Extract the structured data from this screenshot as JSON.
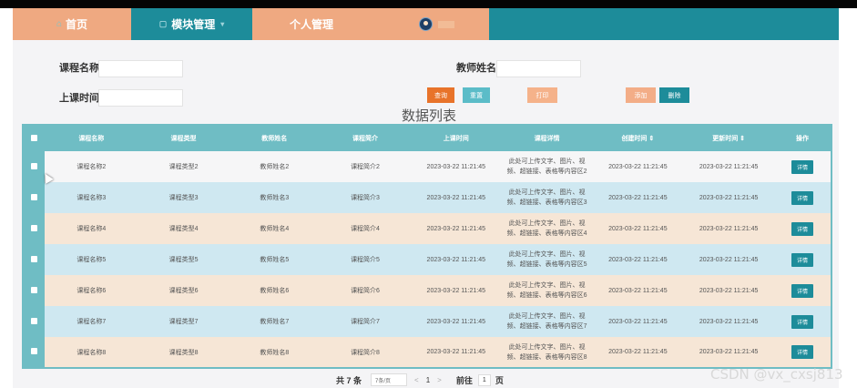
{
  "nav": {
    "home": "首页",
    "module": "模块管理",
    "personal": "个人管理",
    "username": ""
  },
  "search": {
    "course_name_label": "课程名称",
    "teacher_name_label": "教师姓名",
    "class_time_label": "上课时间",
    "course_name_value": "",
    "teacher_name_value": "",
    "class_time_value": ""
  },
  "buttons": {
    "query": "查询",
    "reset": "重置",
    "print": "打印",
    "add": "添加",
    "delete": "删除"
  },
  "list_title": "数据列表",
  "table": {
    "headers": [
      "课程名称",
      "课程类型",
      "教师姓名",
      "课程简介",
      "上课时间",
      "课程详情",
      "创建时间 ⇕",
      "更新时间 ⇕",
      "操作"
    ],
    "rows": [
      {
        "name": "课程名称2",
        "type": "课程类型2",
        "teacher": "教师姓名2",
        "intro": "课程简介2",
        "time": "2023-03-22 11:21:45",
        "detail_1": "此处可上传文字、图片、视",
        "detail_2": "频、超链接、表格等内容区2",
        "created": "2023-03-22 11:21:45",
        "updated": "2023-03-22 11:21:45",
        "action": "详情"
      },
      {
        "name": "课程名称3",
        "type": "课程类型3",
        "teacher": "教师姓名3",
        "intro": "课程简介3",
        "time": "2023-03-22 11:21:45",
        "detail_1": "此处可上传文字、图片、视",
        "detail_2": "频、超链接、表格等内容区3",
        "created": "2023-03-22 11:21:45",
        "updated": "2023-03-22 11:21:45",
        "action": "详情"
      },
      {
        "name": "课程名称4",
        "type": "课程类型4",
        "teacher": "教师姓名4",
        "intro": "课程简介4",
        "time": "2023-03-22 11:21:45",
        "detail_1": "此处可上传文字、图片、视",
        "detail_2": "频、超链接、表格等内容区4",
        "created": "2023-03-22 11:21:45",
        "updated": "2023-03-22 11:21:45",
        "action": "详情"
      },
      {
        "name": "课程名称5",
        "type": "课程类型5",
        "teacher": "教师姓名5",
        "intro": "课程简介5",
        "time": "2023-03-22 11:21:45",
        "detail_1": "此处可上传文字、图片、视",
        "detail_2": "频、超链接、表格等内容区5",
        "created": "2023-03-22 11:21:45",
        "updated": "2023-03-22 11:21:45",
        "action": "详情"
      },
      {
        "name": "课程名称6",
        "type": "课程类型6",
        "teacher": "教师姓名6",
        "intro": "课程简介6",
        "time": "2023-03-22 11:21:45",
        "detail_1": "此处可上传文字、图片、视",
        "detail_2": "频、超链接、表格等内容区6",
        "created": "2023-03-22 11:21:45",
        "updated": "2023-03-22 11:21:45",
        "action": "详情"
      },
      {
        "name": "课程名称7",
        "type": "课程类型7",
        "teacher": "教师姓名7",
        "intro": "课程简介7",
        "time": "2023-03-22 11:21:45",
        "detail_1": "此处可上传文字、图片、视",
        "detail_2": "频、超链接、表格等内容区7",
        "created": "2023-03-22 11:21:45",
        "updated": "2023-03-22 11:21:45",
        "action": "详情"
      },
      {
        "name": "课程名称8",
        "type": "课程类型8",
        "teacher": "教师姓名8",
        "intro": "课程简介8",
        "time": "2023-03-22 11:21:45",
        "detail_1": "此处可上传文字、图片、视",
        "detail_2": "频、超链接、表格等内容区8",
        "created": "2023-03-22 11:21:45",
        "updated": "2023-03-22 11:21:45",
        "action": "详情"
      }
    ]
  },
  "pagination": {
    "total": "共 7 条",
    "page_size": "7条/页",
    "prev": "<",
    "current_page": "1",
    "next": ">",
    "goto": "前往",
    "goto_value": "1",
    "unit": "页"
  },
  "watermark": "CSDN @vx_cxsj813",
  "colors": {
    "teal": "#1d8c9a",
    "peach": "#efa981",
    "table_header": "#6fbdc4",
    "row_pink": "#f6e6d6",
    "row_blue": "#cfe8f1",
    "query_btn": "#e8732a",
    "reset_btn": "#5bbcc8",
    "print_btn": "#f5b28a",
    "add_btn": "#f3ad87",
    "delete_btn": "#1d8c9a"
  }
}
